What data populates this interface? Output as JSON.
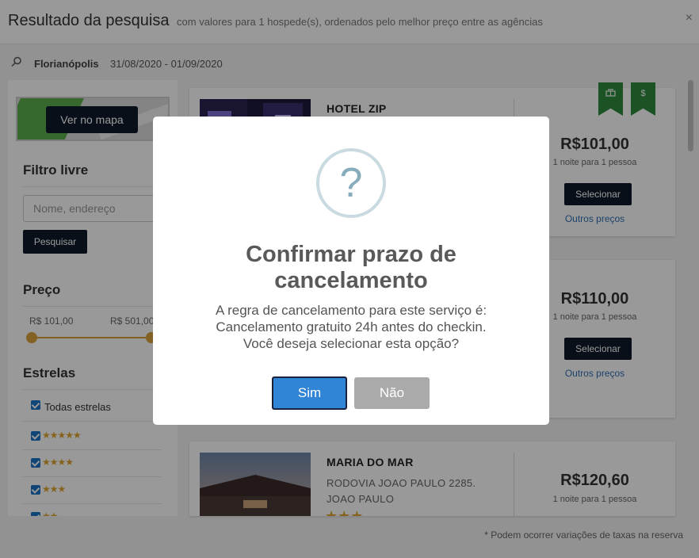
{
  "header": {
    "title": "Resultado da pesquisa",
    "subtitle": "com valores para 1 hospede(s), ordenados pelo melhor preço entre as agências",
    "close_label": "×"
  },
  "search": {
    "city": "Florianópolis",
    "dates": "31/08/2020 - 01/09/2020"
  },
  "sidebar": {
    "map_button": "Ver no mapa",
    "free_filter": {
      "title": "Filtro livre",
      "placeholder": "Nome, endereço",
      "button": "Pesquisar"
    },
    "price": {
      "title": "Preço",
      "min": "R$ 101,00",
      "max": "R$ 501,00"
    },
    "stars": {
      "title": "Estrelas",
      "all_label": "Todas estrelas",
      "rows": [
        "★★★★★",
        "★★★★",
        "★★★",
        "★★"
      ]
    }
  },
  "results": [
    {
      "name": "HOTEL ZIP",
      "price": "R$101,00",
      "nights": "1 noite para 1 pessoa",
      "select": "Selecionar",
      "other": "Outros preços"
    },
    {
      "price": "R$110,00",
      "nights": "1 noite para 1 pessoa",
      "select": "Selecionar",
      "other": "Outros preços"
    },
    {
      "name": "MARIA DO MAR",
      "address_line1": "RODOVIA JOAO PAULO 2285.",
      "address_line2": "JOAO PAULO",
      "stars": "★★★",
      "price": "R$120,60",
      "nights": "1 noite para 1 pessoa"
    }
  ],
  "ribbons": [
    "hotel-icon",
    "dollar-icon"
  ],
  "footnote": "* Podem ocorrer variações de taxas na reserva",
  "modal": {
    "icon": "?",
    "title_line1": "Confirmar prazo de",
    "title_line2": "cancelamento",
    "text_line1": "A regra de cancelamento para este serviço é:",
    "text_line2": "Cancelamento gratuito 24h antes do checkin.",
    "text_line3": "Você deseja selecionar esta opção?",
    "yes": "Sim",
    "no": "Não"
  },
  "colors": {
    "dark_button": "#101a2a",
    "accent_gold": "#d9a23a",
    "link_blue": "#2f6fb5",
    "ribbon_green": "#2e8b3e",
    "confirm_blue": "#3085d6",
    "cancel_gray": "#aaaaaa"
  }
}
